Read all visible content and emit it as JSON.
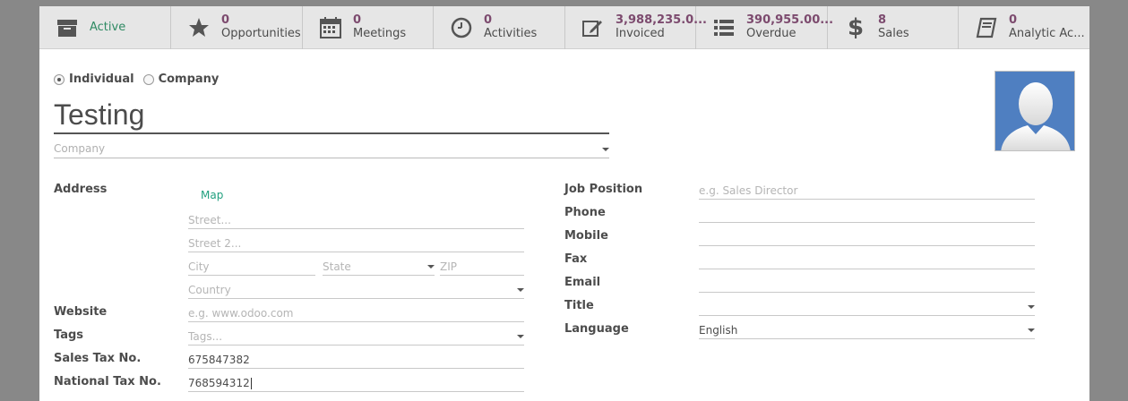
{
  "smart_buttons": [
    {
      "icon": "archive-icon",
      "value": "",
      "label": "Active"
    },
    {
      "icon": "star-icon",
      "value": "0",
      "label": "Opportunities"
    },
    {
      "icon": "calendar-icon",
      "value": "0",
      "label": "Meetings"
    },
    {
      "icon": "clock-icon",
      "value": "0",
      "label": "Activities"
    },
    {
      "icon": "edit-icon",
      "value": "3,988,235.0...",
      "label": "Invoiced"
    },
    {
      "icon": "list-icon",
      "value": "390,955.00...",
      "label": "Overdue"
    },
    {
      "icon": "dollar-icon",
      "value": "8",
      "label": "Sales"
    },
    {
      "icon": "book-icon",
      "value": "0",
      "label": "Analytic Ac..."
    }
  ],
  "company_type": {
    "individual_label": "Individual",
    "company_label": "Company",
    "selected": "Individual"
  },
  "partner": {
    "name": "Testing",
    "company_placeholder": "Company"
  },
  "left_form": {
    "address_label": "Address",
    "map_link": "Map",
    "street_placeholder": "Street...",
    "street2_placeholder": "Street 2...",
    "city_placeholder": "City",
    "state_placeholder": "State",
    "zip_placeholder": "ZIP",
    "country_placeholder": "Country",
    "website_label": "Website",
    "website_placeholder": "e.g. www.odoo.com",
    "tags_label": "Tags",
    "tags_placeholder": "Tags...",
    "sales_tax_label": "Sales Tax No.",
    "sales_tax_value": "675847382",
    "national_tax_label": "National Tax No.",
    "national_tax_value": "768594312"
  },
  "right_form": {
    "job_position_label": "Job Position",
    "job_position_placeholder": "e.g. Sales Director",
    "phone_label": "Phone",
    "phone_value": "",
    "mobile_label": "Mobile",
    "mobile_value": "",
    "fax_label": "Fax",
    "fax_value": "",
    "email_label": "Email",
    "email_value": "",
    "title_label": "Title",
    "title_value": "",
    "language_label": "Language",
    "language_value": "English"
  },
  "colors": {
    "accent": "#7c4a6e",
    "active_green": "#2f8a63",
    "map_link": "#21a07f",
    "avatar_bg": "#4f7fc1"
  }
}
